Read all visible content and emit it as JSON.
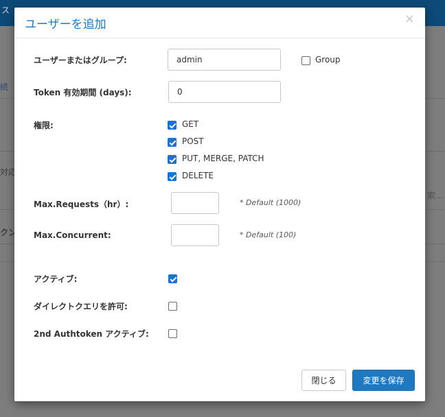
{
  "background": {
    "topbar_fragment": "ス",
    "fragment_link": "続",
    "fragment_text_1": "対応",
    "fragment_search": "索...",
    "fragment_text_2": "クン"
  },
  "modal": {
    "title": "ユーザーを追加",
    "close_symbol": "×",
    "fields": {
      "user_or_group_label": "ユーザーまたはグループ:",
      "user_or_group_value": "admin",
      "group_checkbox_label": "Group",
      "token_expiry_label": "Token 有効期間 (days):",
      "token_expiry_value": "0",
      "permissions_label": "権限:",
      "permissions": [
        {
          "label": "GET",
          "checked": true
        },
        {
          "label": "POST",
          "checked": true
        },
        {
          "label": "PUT, MERGE, PATCH",
          "checked": true
        },
        {
          "label": "DELETE",
          "checked": true
        }
      ],
      "max_requests_label": "Max.Requests（hr）:",
      "max_requests_value": "",
      "max_requests_hint": "* Default (1000)",
      "max_concurrent_label": "Max.Concurrent:",
      "max_concurrent_value": "",
      "max_concurrent_hint": "* Default (100)",
      "active_label": "アクティブ:",
      "active_checked": true,
      "direct_query_label": "ダイレクトクエリを許可:",
      "direct_query_checked": false,
      "auth2_label": "2nd Authtoken アクティブ:",
      "auth2_checked": false,
      "group_checked": false
    },
    "buttons": {
      "close_label": "閉じる",
      "save_label": "変更を保存"
    }
  }
}
